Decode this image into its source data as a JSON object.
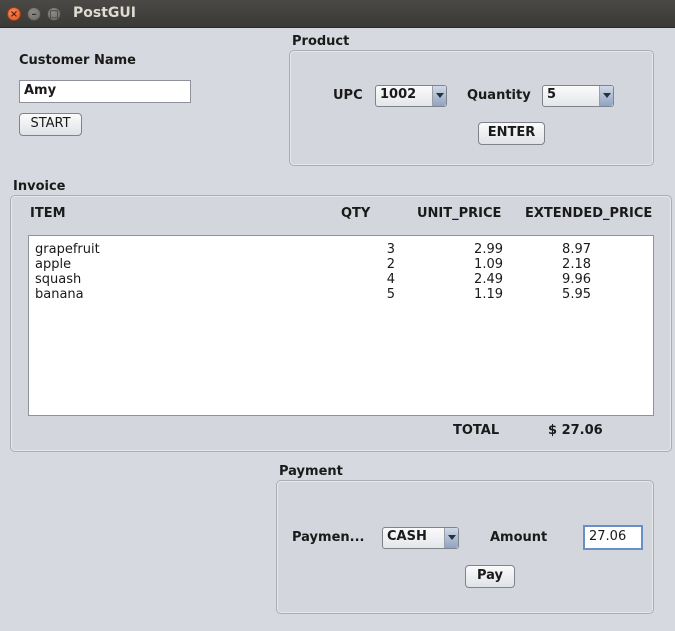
{
  "window": {
    "title": "PostGUI"
  },
  "customer": {
    "label": "Customer Name",
    "value": "Amy",
    "start_label": "START"
  },
  "product": {
    "legend": "Product",
    "upc_label": "UPC",
    "upc_value": "1002",
    "quantity_label": "Quantity",
    "quantity_value": "5",
    "enter_label": "ENTER"
  },
  "invoice": {
    "legend": "Invoice",
    "headers": {
      "item": "ITEM",
      "qty": "QTY",
      "unit_price": "UNIT_PRICE",
      "extended_price": "EXTENDED_PRICE"
    },
    "rows": [
      {
        "item": "grapefruit",
        "qty": "3",
        "unit_price": "2.99",
        "extended_price": "8.97"
      },
      {
        "item": "apple",
        "qty": "2",
        "unit_price": "1.09",
        "extended_price": "2.18"
      },
      {
        "item": "squash",
        "qty": "4",
        "unit_price": "2.49",
        "extended_price": "9.96"
      },
      {
        "item": "banana",
        "qty": "5",
        "unit_price": "1.19",
        "extended_price": "5.95"
      }
    ],
    "total_label": "TOTAL",
    "total_value": "$ 27.06"
  },
  "payment": {
    "legend": "Payment",
    "type_label": "Paymen...",
    "type_value": "CASH",
    "amount_label": "Amount",
    "amount_value": "27.06",
    "pay_label": "Pay"
  }
}
